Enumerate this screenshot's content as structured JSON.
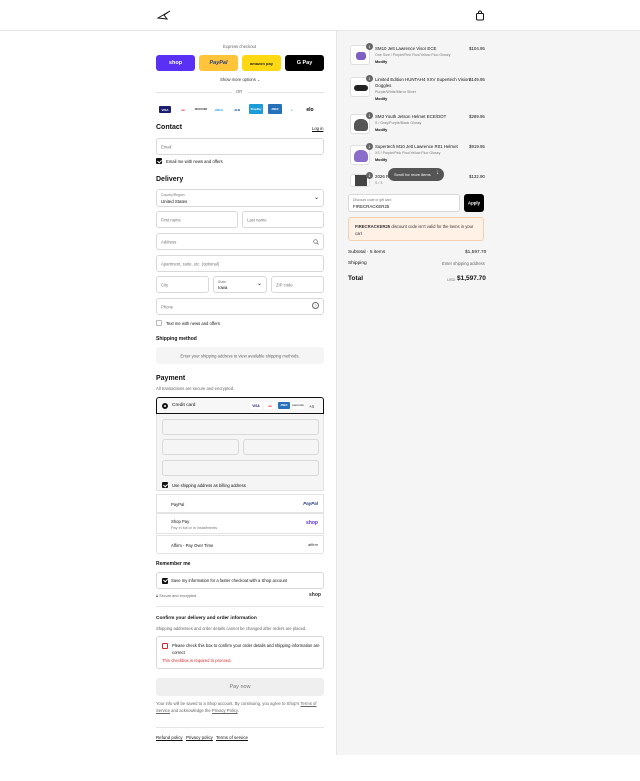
{
  "header": {
    "logo_icon": "alpinestars-logo-icon",
    "bag_icon": "shopping-bag-icon"
  },
  "express": {
    "title": "Express checkout",
    "buttons": [
      {
        "label": "shop",
        "color": "#5a31f4"
      },
      {
        "label": "PayPal",
        "color": "#ffc439"
      },
      {
        "label": "amazon pay",
        "color": "#ffd814"
      },
      {
        "label": "G Pay",
        "color": "#000000"
      }
    ],
    "more": "Show more options",
    "or": "OR"
  },
  "brands": [
    "VISA",
    "MC",
    "DISCOVER",
    "affirm",
    "JCB",
    "ShopPay",
    "AMEX",
    "Diners",
    "elo"
  ],
  "contact": {
    "title": "Contact",
    "login": "Log in",
    "email_ph": "Email",
    "news_label": "Email me with news and offers"
  },
  "delivery": {
    "title": "Delivery",
    "country_label": "Country/Region",
    "country_value": "United States",
    "first_ph": "First name",
    "last_ph": "Last name",
    "address_ph": "Address",
    "apt_ph": "Apartment, suite, etc. (optional)",
    "city_ph": "City",
    "state_label": "State",
    "state_value": "Iowa",
    "zip_ph": "ZIP code",
    "phone_ph": "Phone",
    "text_label": "Text me with news and offers"
  },
  "shipping": {
    "title": "Shipping method",
    "note": "Enter your shipping address to view available shipping methods."
  },
  "payment": {
    "title": "Payment",
    "subtitle": "All transactions are secure and encrypted.",
    "credit": "Credit card",
    "more_cards": "+4",
    "billing_label": "Use shipping address as billing address",
    "paypal": "PayPal",
    "shoppay": "Shop Pay",
    "shoppay_sub": "Pay in full or in installments",
    "affirm": "Affirm - Pay Over Time",
    "paypal_logo": "PayPal",
    "shoppay_logo": "shop",
    "affirm_logo": "affirm"
  },
  "remember": {
    "title": "Remember me",
    "label": "Save my information for a faster checkout with a Shop account",
    "secure": "Secure and encrypted",
    "shop": "shop"
  },
  "confirm": {
    "title": "Confirm your delivery and order information",
    "sub": "Shipping addresses and order details cannot be changed after orders are placed.",
    "check_label": "Please check this box to confirm your order details and shipping information are correct",
    "error": "This checkbox is required to proceed."
  },
  "paynow": "Pay now",
  "legal": {
    "pre": "Your info will be saved to a Shop account. By continuing, you agree to Shop's",
    "terms": "Terms of Service",
    "mid": "and acknowledge the",
    "privacy": "Privacy Policy",
    "end": "."
  },
  "footer_links": [
    "Refund policy",
    "Privacy policy",
    "Terms of service"
  ],
  "items": [
    {
      "qty": "1",
      "name": "SM10 Jett Lawrence Visor ECE",
      "variant": "One Size / Purple/Pink Fluo/Yellow Fluo Glossy",
      "badge": "Modify",
      "price": "$104.95"
    },
    {
      "qty": "1",
      "name": "Limited Edition HUNTAH4 XXV Supertech Vision Goggles",
      "variant": "Purple/White/Mirror Silver",
      "badge": "Modify",
      "price": "$149.95"
    },
    {
      "qty": "1",
      "name": "SM3 Youth Jetson Helmet ECE/DOT",
      "variant": "S / Gray/Purple/Black Glossy",
      "badge": "Modify",
      "price": "$289.95"
    },
    {
      "qty": "1",
      "name": "Supertech M10 Jett Lawrence R01 Helmet",
      "variant": "XS / Purple/Pink Fluo/Yellow Fluo Glossy",
      "badge": "Modify",
      "price": "$919.95"
    },
    {
      "qty": "1",
      "name": "2026 R",
      "variant": "S / 3",
      "badge": "",
      "price": "$132.90"
    }
  ],
  "scroll_hint": "Scroll for more items",
  "discount": {
    "label": "Discount code or gift card",
    "value": "FIRECRACKER25",
    "apply": "Apply",
    "error_code": "FIRECRACKER25",
    "error_text": "discount code isn't valid for the items in your cart"
  },
  "summary": {
    "subtotal_label": "Subtotal · 5 items",
    "subtotal": "$1,597.70",
    "shipping_label": "Shipping",
    "shipping": "Enter shipping address",
    "total_label": "Total",
    "currency": "USD",
    "total": "$1,597.70"
  }
}
